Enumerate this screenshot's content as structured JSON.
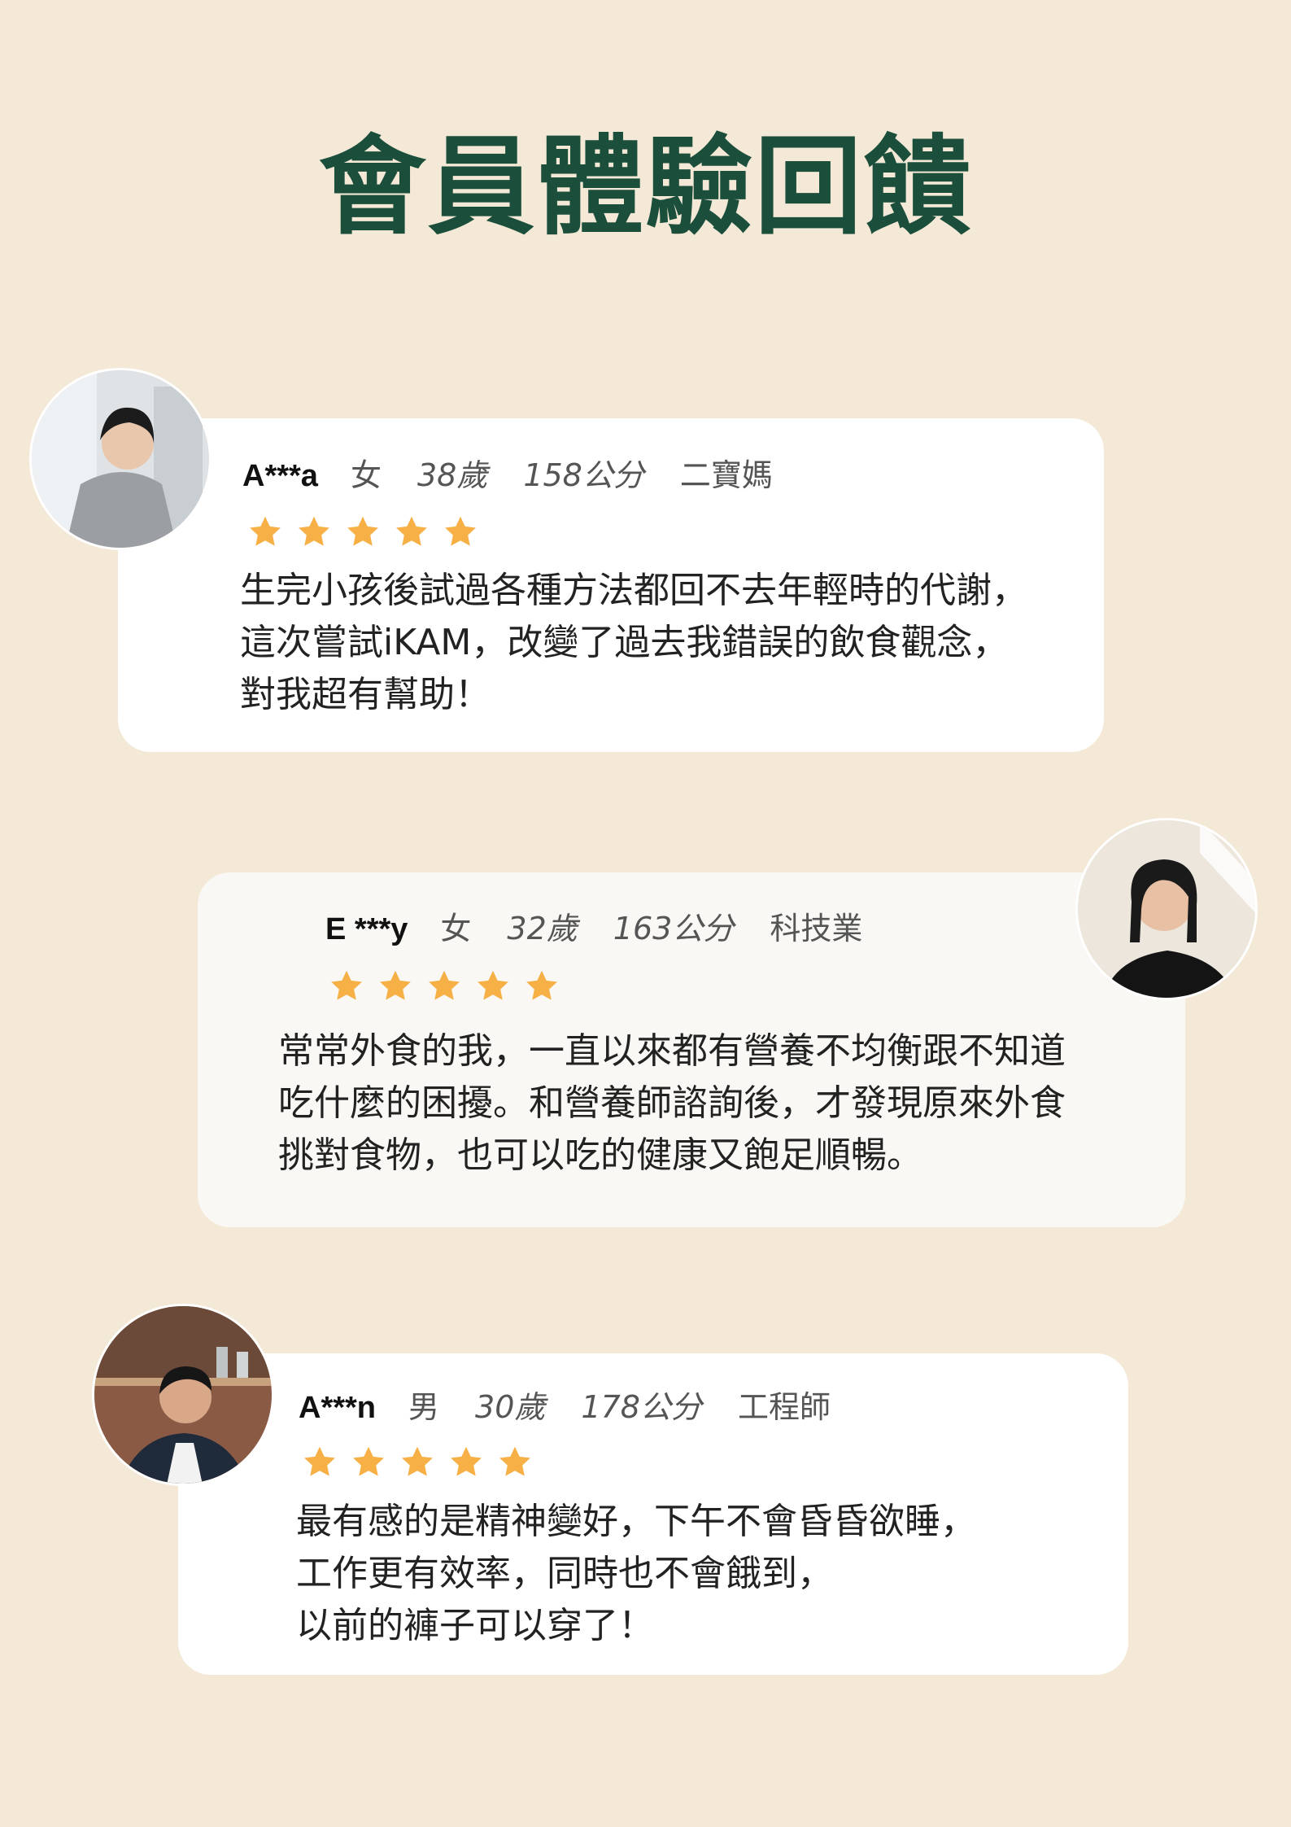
{
  "title": "會員體驗回饋",
  "accent_color": "#1b4f3c",
  "star_color": "#f6b045",
  "reviews": [
    {
      "name": "A***a",
      "gender": "女",
      "age": "38歲",
      "height": "158公分",
      "occupation": "二寶媽",
      "rating": 5,
      "lines": [
        "生完小孩後試過各種方法都回不去年輕時的代謝，",
        "這次嘗試iKAM，改變了過去我錯誤的飲食觀念，",
        "對我超有幫助！"
      ]
    },
    {
      "name": "E ***y",
      "gender": "女",
      "age": "32歲",
      "height": "163公分",
      "occupation": "科技業",
      "rating": 5,
      "lines": [
        "常常外食的我，一直以來都有營養不均衡跟不知道",
        "吃什麼的困擾。和營養師諮詢後，才發現原來外食",
        "挑對食物，也可以吃的健康又飽足順暢。"
      ]
    },
    {
      "name": "A***n",
      "gender": "男",
      "age": "30歲",
      "height": "178公分",
      "occupation": "工程師",
      "rating": 5,
      "lines": [
        "最有感的是精神變好，下午不會昏昏欲睡，",
        "工作更有效率，同時也不會餓到，",
        "以前的褲子可以穿了！"
      ]
    }
  ]
}
